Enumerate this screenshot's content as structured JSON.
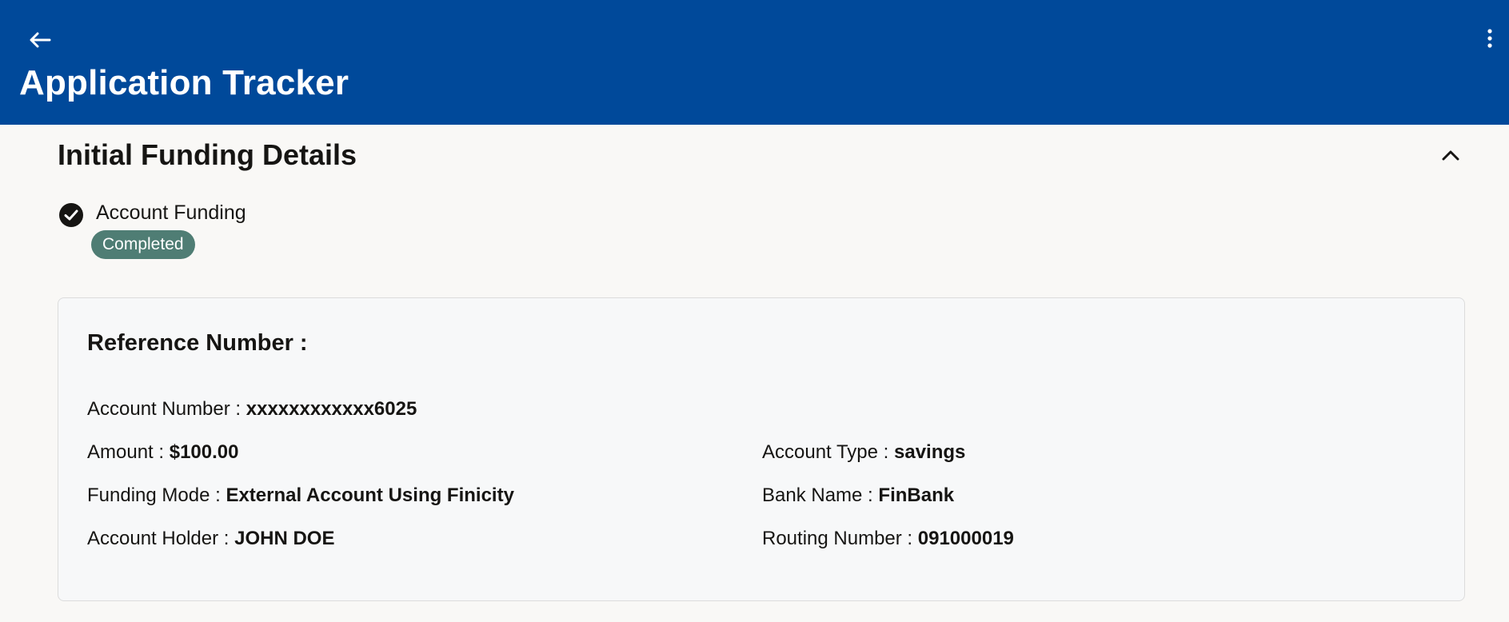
{
  "header": {
    "title": "Application Tracker",
    "back_icon": "arrow-left-icon",
    "more_icon": "more-vertical-icon",
    "background_color": "#00499a"
  },
  "section": {
    "title": "Initial Funding Details",
    "collapse_icon": "chevron-up-icon",
    "status_item": {
      "label": "Account Funding",
      "badge": "Completed",
      "badge_color": "#4f7d74",
      "icon": "check-circle-icon"
    }
  },
  "details": {
    "title": "Reference Number :",
    "fields": {
      "account_number": {
        "label": "Account Number : ",
        "value": "xxxxxxxxxxxx6025"
      },
      "amount": {
        "label": "Amount : ",
        "value": "$100.00"
      },
      "account_type": {
        "label": "Account Type : ",
        "value": "savings"
      },
      "funding_mode": {
        "label": "Funding Mode : ",
        "value": "External Account Using Finicity"
      },
      "bank_name": {
        "label": "Bank Name : ",
        "value": "FinBank"
      },
      "account_holder": {
        "label": "Account Holder : ",
        "value": "JOHN DOE"
      },
      "routing_number": {
        "label": "Routing Number : ",
        "value": "091000019"
      }
    }
  }
}
